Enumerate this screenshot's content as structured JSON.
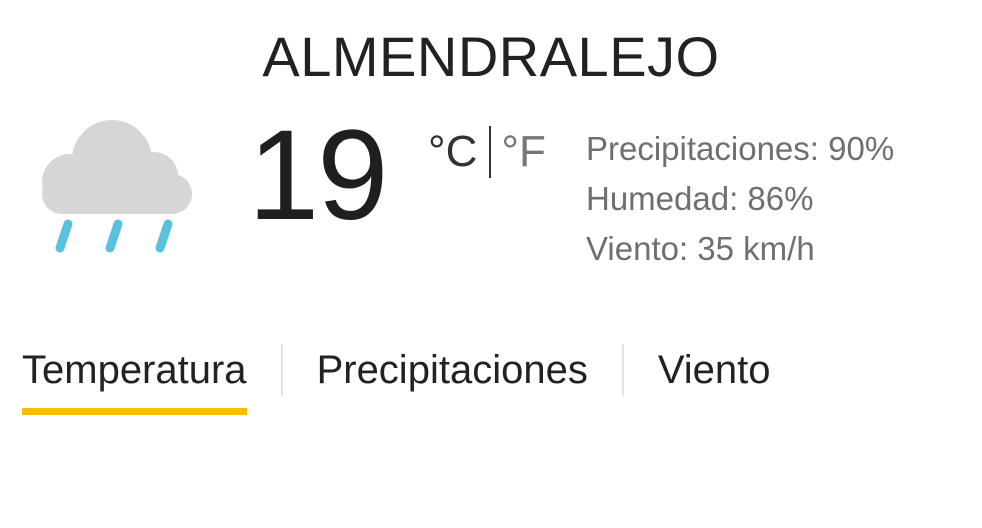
{
  "location": {
    "city": "ALMENDRALEJO"
  },
  "current": {
    "temperature": "19",
    "icon": "rain-cloud-icon",
    "units": {
      "celsius": "°C",
      "fahrenheit": "°F"
    },
    "details": {
      "precipitation": "Precipitaciones: 90%",
      "humidity": "Humedad: 86%",
      "wind": "Viento: 35 km/h"
    }
  },
  "tabs": [
    {
      "label": "Temperatura",
      "active": true
    },
    {
      "label": "Precipitaciones",
      "active": false
    },
    {
      "label": "Viento",
      "active": false
    }
  ],
  "colors": {
    "cloud": "#d6d6d6",
    "rain": "#5bc0de",
    "tab_indicator": "#fbbc04"
  }
}
